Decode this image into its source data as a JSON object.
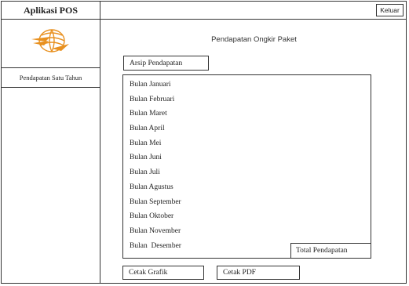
{
  "sidebar": {
    "app_title": "Aplikasi POS",
    "logo_icon": "pos-indonesia-logo",
    "items": [
      {
        "label": "Pendapatan Satu Tahun"
      }
    ]
  },
  "header": {
    "logout_label": "Keluar"
  },
  "main": {
    "title": "Pendapatan Ongkir Paket",
    "archive_label": "Arsip Pendapatan",
    "months": [
      "Bulan Januari",
      "Bulan Februari",
      "Bulan Maret",
      "Bulan April",
      "Bulan Mei",
      "Bulan Juni",
      "Bulan Juli",
      "Bulan Agustus",
      "Bulan September",
      "Bulan Oktober",
      "Bulan November",
      "Bulan  Desember"
    ],
    "total_label": "Total Pendapatan",
    "print_chart_label": "Cetak Grafik",
    "print_pdf_label": "Cetak PDF"
  },
  "colors": {
    "logo_orange": "#e8901f",
    "border": "#333333"
  }
}
